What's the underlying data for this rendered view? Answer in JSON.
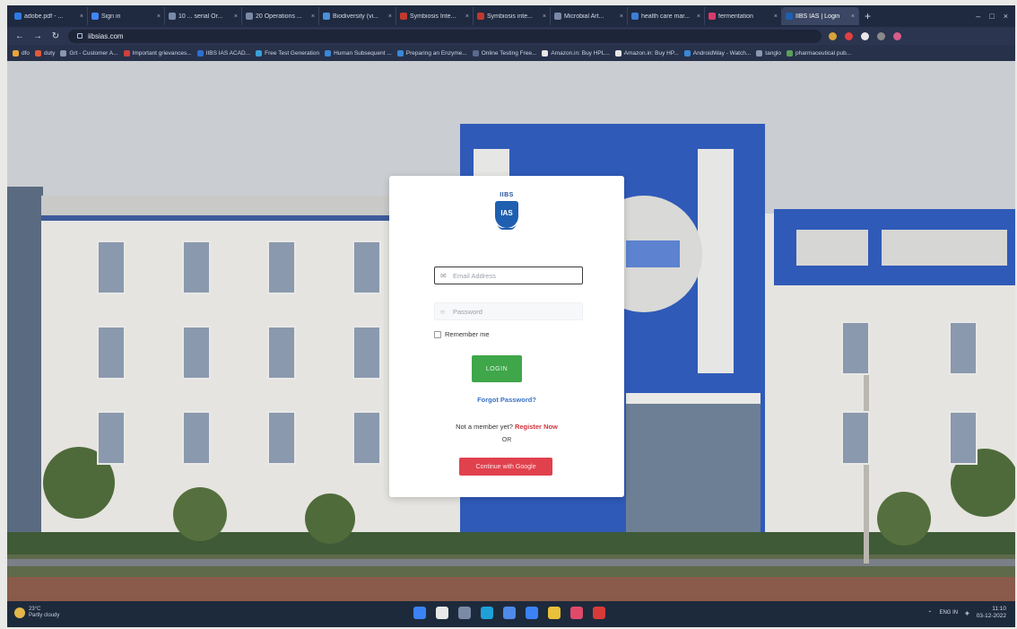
{
  "browser": {
    "tabs": [
      {
        "label": "adobe.pdf - ...",
        "color": "#2d7be0"
      },
      {
        "label": "Sign in",
        "color": "#4285f4"
      },
      {
        "label": "10 ... serial Or...",
        "color": "#7a8aa6"
      },
      {
        "label": "20 Operations ...",
        "color": "#7a8aa6"
      },
      {
        "label": "Biodiversity (vi...",
        "color": "#4a90d9"
      },
      {
        "label": "Symbiosis Inte...",
        "color": "#c0392b"
      },
      {
        "label": "Symbiosis inte...",
        "color": "#c0392b"
      },
      {
        "label": "Microbial Art...",
        "color": "#7a8aa6"
      },
      {
        "label": "health care mar...",
        "color": "#3b7dd8"
      },
      {
        "label": "fermentation",
        "color": "#d83b6a"
      },
      {
        "label": "IIBS IAS | Login",
        "color": "#1f5fb0",
        "active": true
      }
    ],
    "url": "iibsias.com",
    "bookmarks": [
      {
        "label": "dfo",
        "color": "#e8a33a"
      },
      {
        "label": "duty",
        "color": "#e05a3a"
      },
      {
        "label": "Grt - Customer A...",
        "color": "#8a97b0"
      },
      {
        "label": "Important grievances...",
        "color": "#d04040"
      },
      {
        "label": "IIBS IAS ACAD...",
        "color": "#2d6fd0"
      },
      {
        "label": "Free Test Generation",
        "color": "#3aa0d8"
      },
      {
        "label": "Human Subsequent ...",
        "color": "#3a88d8"
      },
      {
        "label": "Preparing an Enzyme...",
        "color": "#3a88d8"
      },
      {
        "label": "Online Testing Free...",
        "color": "#5a6a8a"
      },
      {
        "label": "Amazon.in: Buy HPL...",
        "color": "#e8e8e8"
      },
      {
        "label": "Amazon.in: Buy HP...",
        "color": "#e8e8e8"
      },
      {
        "label": "AndroidWay - Watch...",
        "color": "#3a88d8"
      },
      {
        "label": "tanglo",
        "color": "#8a97b0"
      },
      {
        "label": "pharmaceutical pub...",
        "color": "#5aa05a"
      }
    ],
    "extension_colors": [
      "#d8a33a",
      "#e04040",
      "#e8e8e8",
      "#8a8a8a",
      "#d85c8a"
    ]
  },
  "login": {
    "logo_text": "IIBS",
    "logo_inner": "IAS",
    "email_placeholder": "Email Address",
    "password_placeholder": "Password",
    "remember_label": "Remember me",
    "login_button": "LOGIN",
    "forgot_link": "Forgot Password?",
    "not_member": "Not a member yet?",
    "register_link": "Register Now",
    "or_text": "OR",
    "google_button": "Continue with Google"
  },
  "taskbar": {
    "weather_temp": "23°C",
    "weather_desc": "Partly cloudy",
    "icon_colors": [
      "#3b82f6",
      "#e8e8e8",
      "#7a8aa6",
      "#1fa0d8",
      "#4f8ae8",
      "#3b82f6",
      "#e8c03a",
      "#e04a6a",
      "#d83a3a"
    ],
    "lang": "ENG IN",
    "time": "11:10",
    "date": "03-12-2022"
  },
  "colors": {
    "login_green": "#3fa64a",
    "google_red": "#e0414d",
    "link_blue": "#3c72c4",
    "register_red": "#d2343f",
    "brand_blue": "#1f5fb0"
  }
}
